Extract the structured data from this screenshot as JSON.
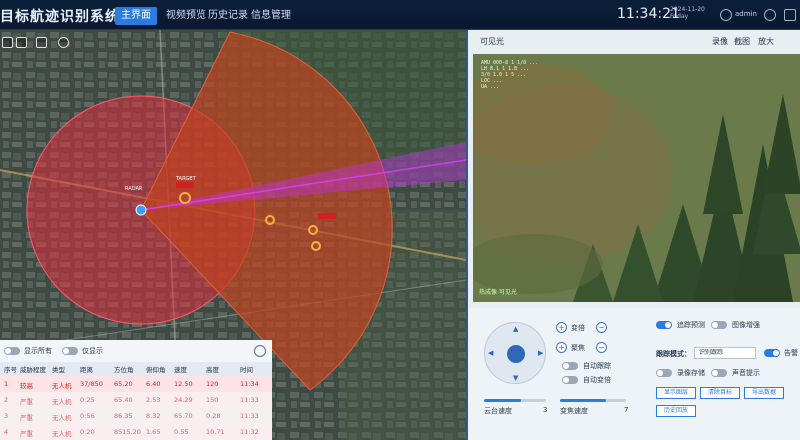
{
  "header": {
    "title": "目标航迹识别系统",
    "nav": [
      "主界面",
      "视频预览",
      "历史记录",
      "信息管理"
    ],
    "time": "11:34:21",
    "date": "2024-11-20",
    "weekday": "Friday",
    "user": "admin"
  },
  "video": {
    "title": "可见光",
    "actions": [
      "录像",
      "截图",
      "放大"
    ],
    "osd_lines": [
      "AMU 000-8 1 1/8 ...",
      "LH B.1 1 1.B ...",
      "3/0 1.0 1 5 ...",
      "LOC  ...",
      "UA ..."
    ],
    "tag": "热成像 可见光"
  },
  "ptz": {
    "zoom_label": "变倍",
    "focus_label": "聚焦",
    "auto_track_label": "自动跟踪",
    "auto_zoom_label": "自动变倍",
    "pan_speed_label": "云台速度",
    "pan_speed_value": "3",
    "pan_speed_fraction": 0.6,
    "zoom_speed_label": "变焦速度",
    "zoom_speed_value": "7",
    "zoom_speed_fraction": 0.7
  },
  "settings": {
    "toggle_track": "追踪预测",
    "toggle_gallery": "图像增强",
    "mode_label": "跟踪模式：",
    "mode_value": "识别跟踪",
    "toggle_alarm": "告警",
    "toggle_record": "录像存储",
    "toggle_beep": "声音提示",
    "buttons": [
      "显示图层",
      "清除目标",
      "导出数据",
      "历史回放"
    ]
  },
  "table": {
    "filter1": "显示所有",
    "filter2": "仅显示",
    "headers": [
      "序号",
      "威胁程度",
      "类型",
      "距离",
      "方位角",
      "俯仰角",
      "速度",
      "高度",
      "时间"
    ],
    "rows": [
      [
        "1",
        "较高",
        "无人机",
        "37/850",
        "65.20",
        "6.40",
        "12.50",
        "120",
        "11:34"
      ],
      [
        "2",
        "严重",
        "无人机",
        "0:25",
        "65.40",
        "2.53",
        "24.29",
        "150",
        "11:33"
      ],
      [
        "3",
        "严重",
        "无人机",
        "0:56",
        "86.35",
        "8.32",
        "65.70",
        "0.28",
        "11:33"
      ],
      [
        "4",
        "严重",
        "无人机",
        "0:20",
        "8515.20",
        "1.65",
        "0.55",
        "10.71",
        "11:32"
      ]
    ]
  },
  "map_labels": [
    "RADAR",
    "TARGET"
  ],
  "colors": {
    "accent": "#2c7be0",
    "threat_high": "#d02020",
    "threat_severe": "#e06060"
  }
}
